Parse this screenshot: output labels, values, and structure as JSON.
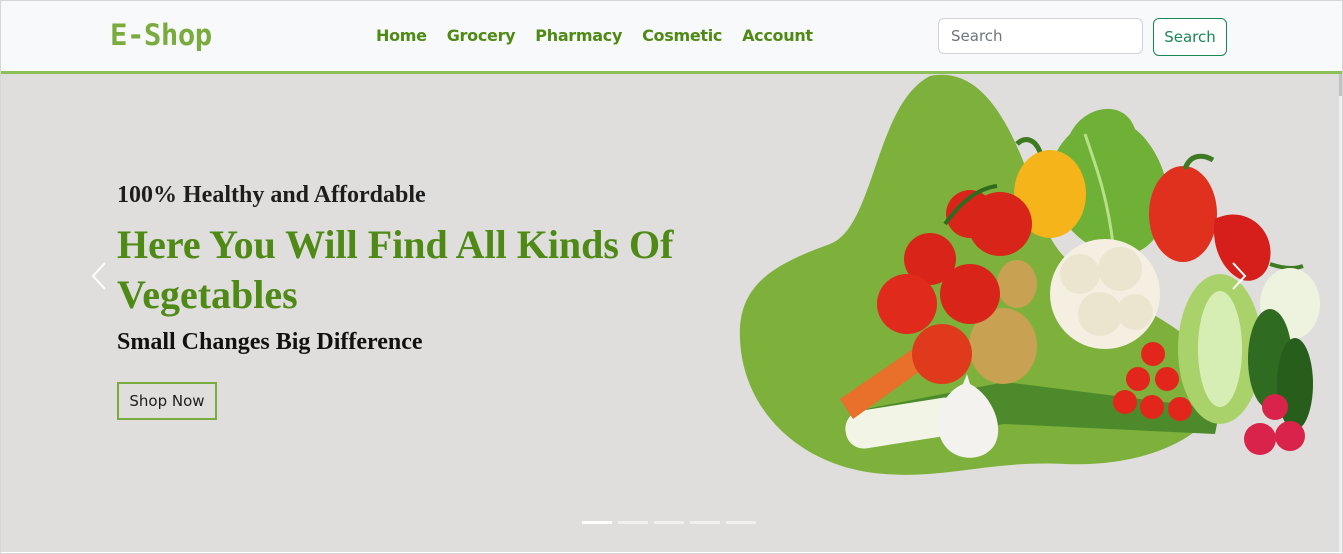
{
  "brand": "E-Shop",
  "nav": {
    "links": [
      "Home",
      "Grocery",
      "Pharmacy",
      "Cosmetic",
      "Account"
    ]
  },
  "search": {
    "placeholder": "Search",
    "button_label": "Search"
  },
  "hero": {
    "subtitle": "100% Healthy and Affordable",
    "title": "Here You Will Find All Kinds Of Vegetables",
    "tagline": "Small Changes Big Difference",
    "cta_label": "Shop Now",
    "image": "vegetables-image",
    "slide_count": 5,
    "active_slide": 1
  },
  "colors": {
    "brand_green": "#7aab3f",
    "title_green": "#4e8a15",
    "hero_background": "#dfdedd",
    "blob_green": "#7db13c",
    "search_button": "#198754"
  },
  "icons": {
    "prev": "chevron-left-icon",
    "next": "chevron-right-icon"
  }
}
